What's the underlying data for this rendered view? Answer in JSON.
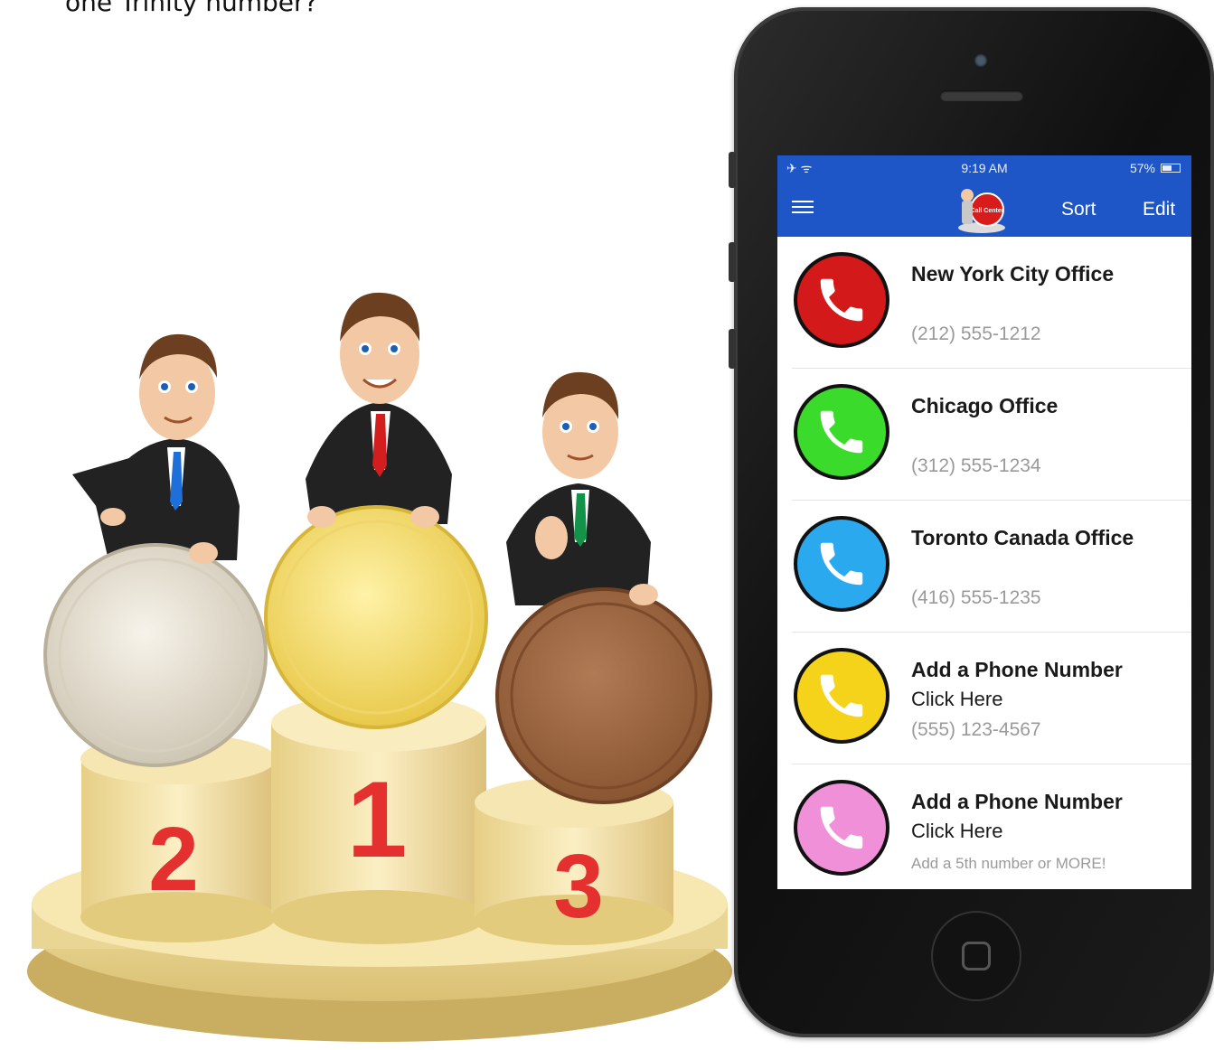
{
  "caption": "one Trinity number?",
  "podium": {
    "places": [
      "2",
      "1",
      "3"
    ],
    "place_color": "#e53030"
  },
  "phone": {
    "statusbar": {
      "left": "✈ ᯤ",
      "time": "9:19 AM",
      "battery": "57%",
      "battery_level": 0.57
    },
    "navbar": {
      "menu_icon": "hamburger-menu-icon",
      "logo_text": "Call Center",
      "sort_label": "Sort",
      "edit_label": "Edit",
      "bar_color": "#1e56c8"
    },
    "contacts": [
      {
        "name": "New York City Office",
        "sub": "",
        "number": "(212) 555-1212",
        "color": "#d31919"
      },
      {
        "name": "Chicago Office",
        "sub": "",
        "number": "(312) 555-1234",
        "color": "#3adb2a"
      },
      {
        "name": "Toronto Canada Office",
        "sub": "",
        "number": "(416) 555-1235",
        "color": "#2aa9ee"
      },
      {
        "name": "Add a Phone Number",
        "sub": "Click Here",
        "number": "(555) 123-4567",
        "color": "#f5d31a"
      },
      {
        "name": "Add a Phone Number",
        "sub": "Click Here",
        "number": "Add a 5th number or MORE!",
        "color": "#f090d8"
      }
    ]
  }
}
